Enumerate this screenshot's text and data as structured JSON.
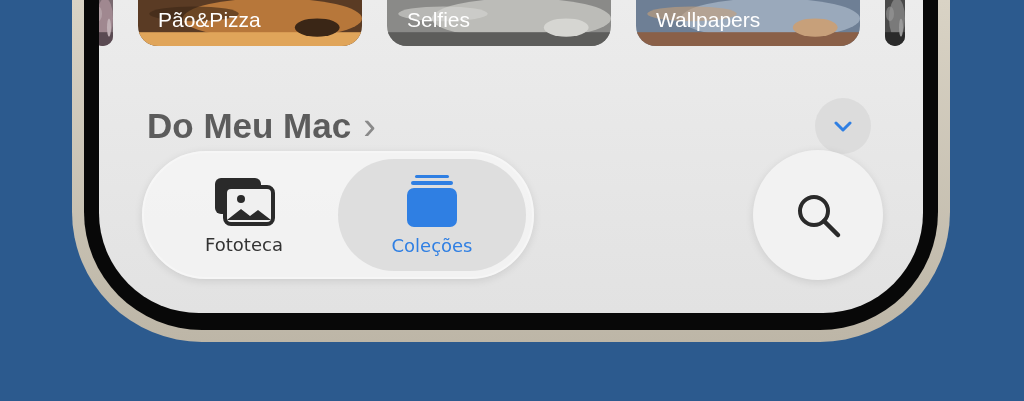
{
  "albums": [
    {
      "title": "Pão&Pizza"
    },
    {
      "title": "Selfies"
    },
    {
      "title": "Wallpapers"
    }
  ],
  "section": {
    "title": "Do Meu Mac",
    "chevron": "›"
  },
  "tabs": [
    {
      "label": "Fototeca",
      "kind": "library",
      "selected": false
    },
    {
      "label": "Coleções",
      "kind": "collections",
      "selected": true
    }
  ]
}
